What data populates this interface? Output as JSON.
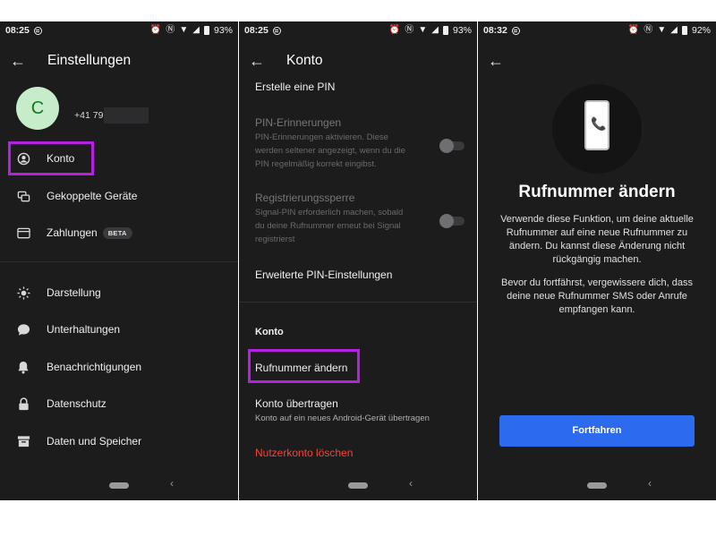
{
  "panel1": {
    "status": {
      "time": "08:25",
      "battery": "93%"
    },
    "title": "Einstellungen",
    "profile": {
      "initial": "C",
      "phone": "+41 79"
    },
    "menu": [
      {
        "label": "Konto",
        "icon": "person-circle-icon"
      },
      {
        "label": "Gekoppelte Geräte",
        "icon": "linked-devices-icon"
      },
      {
        "label": "Zahlungen",
        "icon": "card-icon",
        "badge": "BETA"
      }
    ],
    "menu2": [
      {
        "label": "Darstellung",
        "icon": "sun-icon"
      },
      {
        "label": "Unterhaltungen",
        "icon": "chat-bubble-icon"
      },
      {
        "label": "Benachrichtigungen",
        "icon": "bell-icon"
      },
      {
        "label": "Datenschutz",
        "icon": "lock-icon"
      },
      {
        "label": "Daten und Speicher",
        "icon": "archive-icon"
      }
    ]
  },
  "panel2": {
    "status": {
      "time": "08:25",
      "battery": "93%"
    },
    "title": "Konto",
    "create_pin": "Erstelle eine PIN",
    "pin_reminders": {
      "title": "PIN-Erinnerungen",
      "desc": "PIN-Erinnerungen aktivieren. Diese werden seltener angezeigt, wenn du die PIN regelmäßig korrekt eingibst."
    },
    "reg_lock": {
      "title": "Registrierungssperre",
      "desc": "Signal-PIN erforderlich machen, sobald du deine Rufnummer erneut bei Signal registrierst"
    },
    "advanced_pin": "Erweiterte PIN-Einstellungen",
    "section_account": "Konto",
    "change_number": "Rufnummer ändern",
    "transfer": {
      "title": "Konto übertragen",
      "desc": "Konto auf ein neues Android-Gerät übertragen"
    },
    "delete_account": "Nutzerkonto löschen"
  },
  "panel3": {
    "status": {
      "time": "08:32",
      "battery": "92%"
    },
    "heading": "Rufnummer ändern",
    "para1": "Verwende diese Funktion, um deine aktuelle Rufnummer auf eine neue Rufnummer zu ändern. Du kannst diese Änderung nicht rückgängig machen.",
    "para2": "Bevor du fortfährst, vergewissere dich, dass deine neue Rufnummer SMS oder Anrufe empfangen kann.",
    "button": "Fortfahren"
  },
  "colors": {
    "highlight": "#b620e0",
    "accent": "#2c6bed",
    "danger": "#f44336",
    "background": "#1c1c1d"
  }
}
